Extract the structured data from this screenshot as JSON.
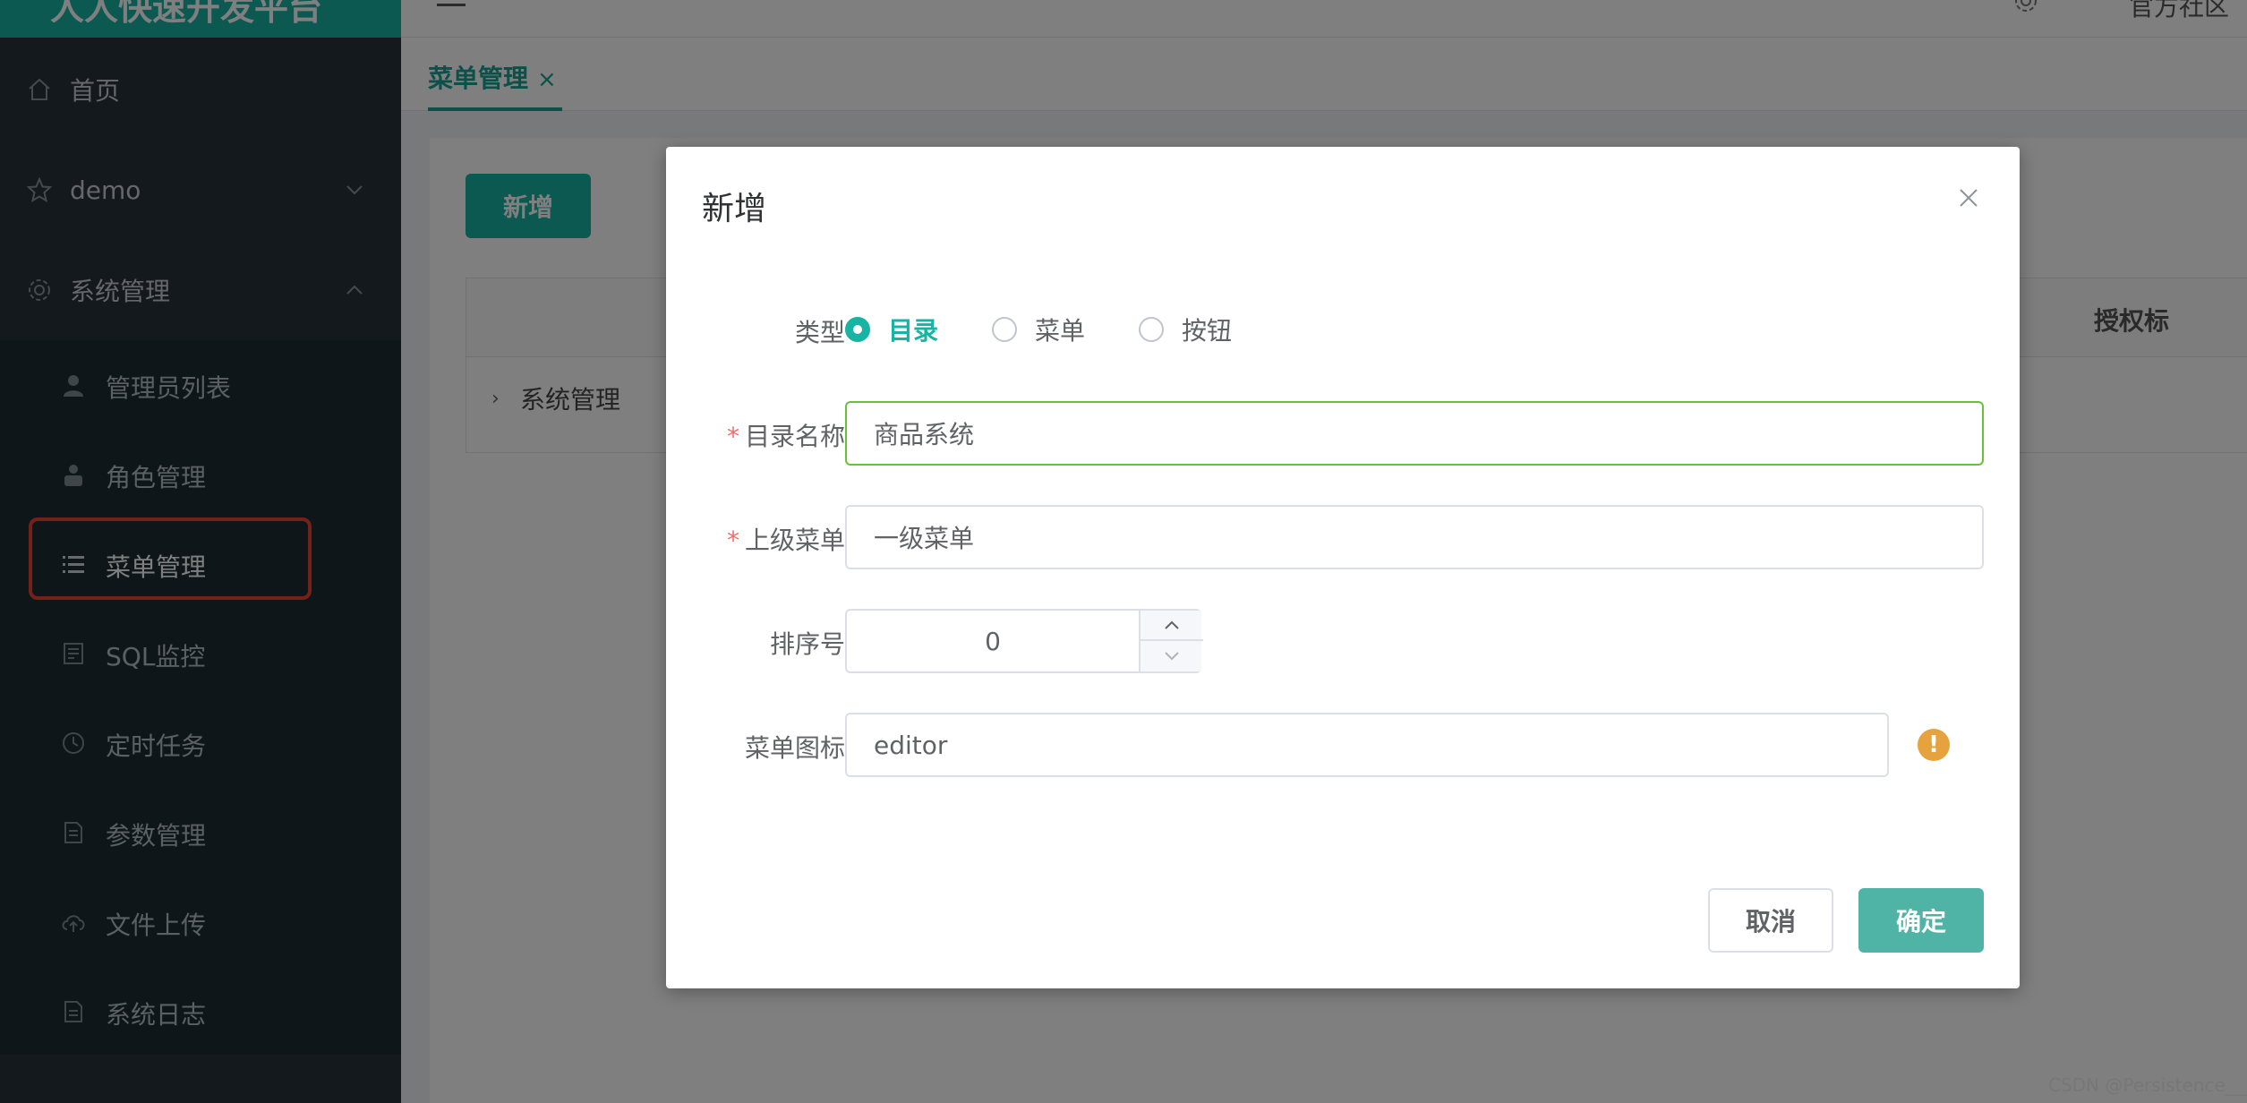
{
  "app": {
    "brand": "人人快速开发平台",
    "user": "官方社区"
  },
  "sidebar": {
    "items": [
      {
        "label": "首页",
        "icon": "home-icon"
      },
      {
        "label": "demo",
        "icon": "star-icon"
      },
      {
        "label": "系统管理",
        "icon": "gear-icon"
      }
    ],
    "subitems": [
      {
        "label": "管理员列表",
        "icon": "user-icon"
      },
      {
        "label": "角色管理",
        "icon": "role-icon"
      },
      {
        "label": "菜单管理",
        "icon": "menu-list-icon"
      },
      {
        "label": "SQL监控",
        "icon": "sql-icon"
      },
      {
        "label": "定时任务",
        "icon": "clock-icon"
      },
      {
        "label": "参数管理",
        "icon": "params-icon"
      },
      {
        "label": "文件上传",
        "icon": "upload-icon"
      },
      {
        "label": "系统日志",
        "icon": "log-icon"
      }
    ],
    "active": "菜单管理"
  },
  "tabs": [
    {
      "label": "菜单管理",
      "close": "×"
    }
  ],
  "page": {
    "add_button": "新增",
    "table": {
      "col_auth": "授权标",
      "rows": [
        {
          "label": "系统管理"
        }
      ]
    }
  },
  "dialog": {
    "title": "新增",
    "type_label": "类型",
    "type_options": [
      "目录",
      "菜单",
      "按钮"
    ],
    "type_selected": "目录",
    "name_label": "目录名称",
    "name_value": "商品系统",
    "parent_label": "上级菜单",
    "parent_value": "一级菜单",
    "order_label": "排序号",
    "order_value": "0",
    "icon_label": "菜单图标",
    "icon_value": "editor",
    "cancel": "取消",
    "confirm": "确定"
  },
  "watermark": "CSDN @Persistence___",
  "colors": {
    "accent": "#17b3a3",
    "sidebar": "#263238",
    "highlight": "#e8432f",
    "warning": "#e6a23c"
  }
}
